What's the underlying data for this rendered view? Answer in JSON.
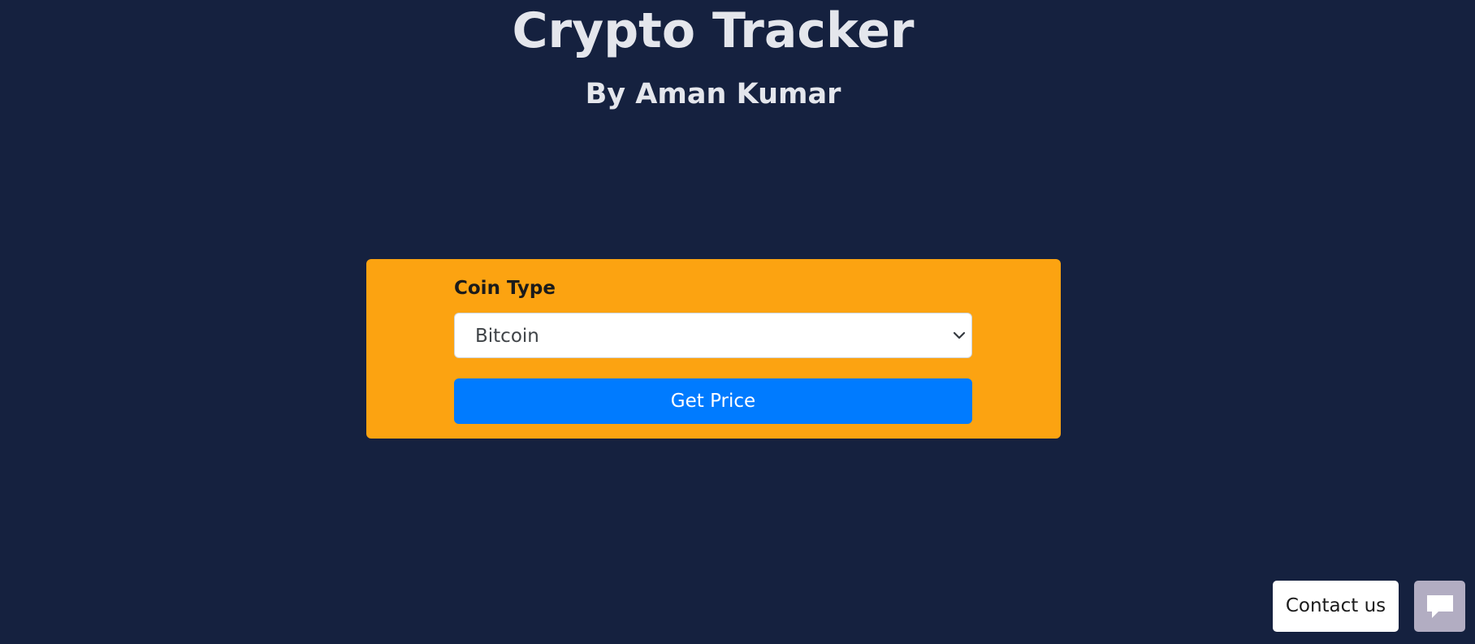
{
  "header": {
    "title": "Crypto Tracker",
    "subtitle": "By Aman Kumar"
  },
  "form": {
    "label": "Coin Type",
    "select": {
      "selected": "Bitcoin"
    },
    "submit_label": "Get Price"
  },
  "widget": {
    "contact_label": "Contact us",
    "chat_icon": "chat-bubble-icon"
  },
  "colors": {
    "background": "#15213f",
    "card": "#fca311",
    "button": "#007bff",
    "chat_button": "#b2adc2"
  }
}
